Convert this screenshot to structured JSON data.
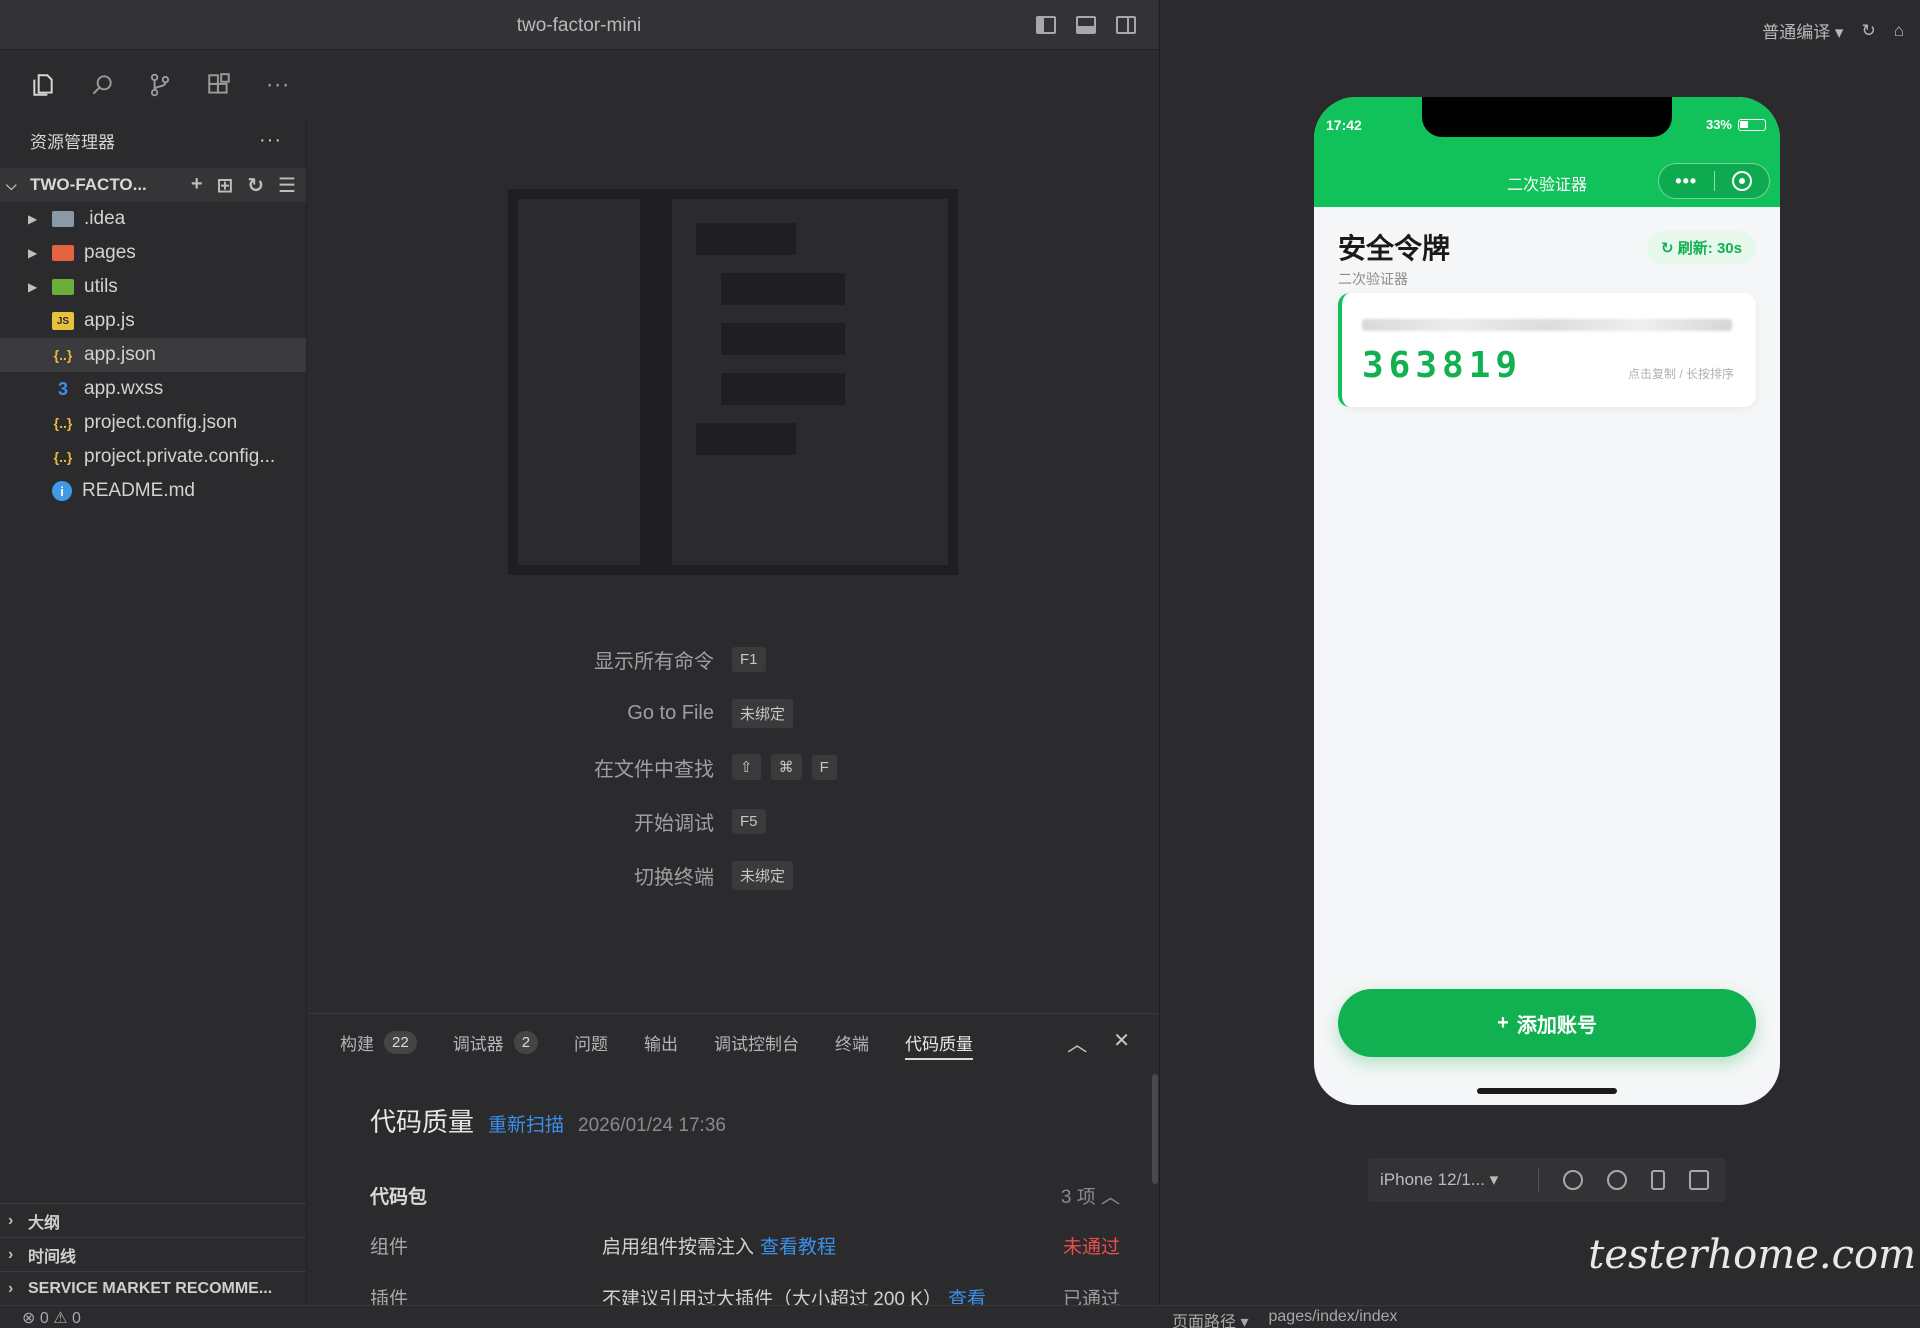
{
  "window": {
    "title": "two-factor-mini"
  },
  "sidebar": {
    "header": "资源管理器",
    "project": "TWO-FACTO...",
    "files": [
      {
        "name": ".idea",
        "type": "folder",
        "expandable": true
      },
      {
        "name": "pages",
        "type": "folder",
        "expandable": true
      },
      {
        "name": "utils",
        "type": "folder",
        "expandable": true
      },
      {
        "name": "app.js",
        "type": "js"
      },
      {
        "name": "app.json",
        "type": "json",
        "active": true
      },
      {
        "name": "app.wxss",
        "type": "css"
      },
      {
        "name": "project.config.json",
        "type": "json"
      },
      {
        "name": "project.private.config...",
        "type": "json"
      },
      {
        "name": "README.md",
        "type": "info"
      }
    ],
    "sections": [
      "大纲",
      "时间线",
      "SERVICE MARKET RECOMME..."
    ]
  },
  "editor": {
    "shortcuts": [
      {
        "label": "显示所有命令",
        "keys": [
          "F1"
        ]
      },
      {
        "label": "Go to File",
        "keys": [
          "未绑定"
        ]
      },
      {
        "label": "在文件中查找",
        "keys": [
          "⇧",
          "⌘",
          "F"
        ]
      },
      {
        "label": "开始调试",
        "keys": [
          "F5"
        ]
      },
      {
        "label": "切换终端",
        "keys": [
          "未绑定"
        ]
      }
    ]
  },
  "panel": {
    "tabs": [
      {
        "label": "构建",
        "badge": "22"
      },
      {
        "label": "调试器",
        "badge": "2"
      },
      {
        "label": "问题"
      },
      {
        "label": "输出"
      },
      {
        "label": "调试控制台"
      },
      {
        "label": "终端"
      },
      {
        "label": "代码质量",
        "active": true
      }
    ],
    "quality": {
      "title": "代码质量",
      "rescan": "重新扫描",
      "timestamp": "2026/01/24 17:36",
      "section": "代码包",
      "count": "3 项",
      "rows": [
        {
          "key": "组件",
          "value": "启用组件按需注入",
          "link": "查看教程",
          "status": "未通过"
        },
        {
          "key": "插件",
          "value": "不建议引用过大插件（大小超过 200 K）",
          "link": "查看",
          "status": "已通过"
        }
      ]
    }
  },
  "statusbar": {
    "errors": "0",
    "warnings": "0",
    "path_label": "页面路径",
    "path": "pages/index/index"
  },
  "simulator": {
    "compile_mode": "普通编译",
    "phone": {
      "time": "17:42",
      "battery": "33%",
      "nav_title": "二次验证器",
      "heading": "安全令牌",
      "subheading": "二次验证器",
      "refresh": "刷新: 30s",
      "code": "363819",
      "hint": "点击复制 / 长按排序",
      "add_button": "添加账号"
    },
    "device": "iPhone 12/1...",
    "watermark": "testerhome.com"
  },
  "colors": {
    "accent_green": "#11c25a",
    "link_blue": "#3b8fe8",
    "error_red": "#e5504a"
  }
}
